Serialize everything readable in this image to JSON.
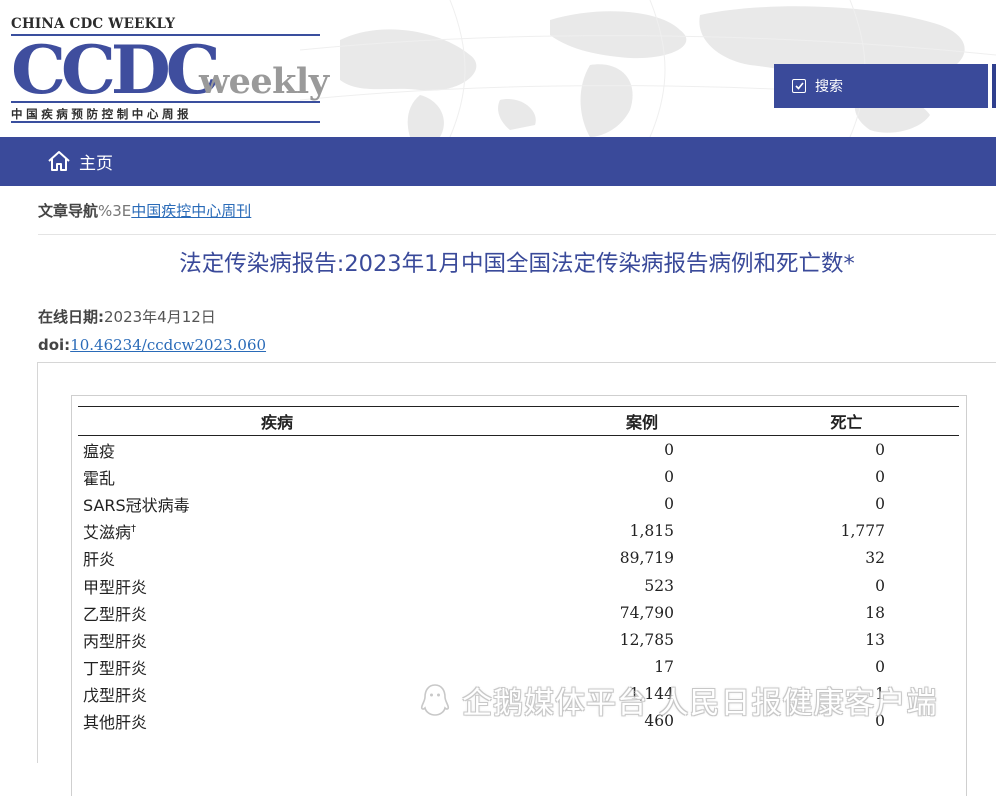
{
  "header": {
    "brand_top": "CHINA CDC WEEKLY",
    "logo_main": "CCDC",
    "logo_suffix": "weekly",
    "brand_subtitle": "中国疾病预防控制中心周报",
    "search_label": "搜索"
  },
  "nav": {
    "home_label": "主页"
  },
  "breadcrumb": {
    "label": "文章导航",
    "separator": "%3E",
    "link": "中国疾控中心周刊"
  },
  "article": {
    "title": "法定传染病报告:2023年1月中国全国法定传染病报告病例和死亡数*",
    "date_label": "在线日期:",
    "date_value": "2023年4月12日",
    "doi_label": "doi:",
    "doi_value": "10.46234/ccdcw2023.060"
  },
  "table": {
    "headers": {
      "disease": "疾病",
      "cases": "案例",
      "deaths": "死亡"
    },
    "rows": [
      {
        "disease": "瘟疫",
        "cases": "0",
        "deaths": "0"
      },
      {
        "disease": "霍乱",
        "cases": "0",
        "deaths": "0"
      },
      {
        "disease": "SARS冠状病毒",
        "cases": "0",
        "deaths": "0"
      },
      {
        "disease": "艾滋病",
        "sup": "†",
        "cases": "1,815",
        "deaths": "1,777"
      },
      {
        "disease": "肝炎",
        "cases": "89,719",
        "deaths": "32"
      },
      {
        "disease": "甲型肝炎",
        "cases": "523",
        "deaths": "0"
      },
      {
        "disease": "乙型肝炎",
        "cases": "74,790",
        "deaths": "18"
      },
      {
        "disease": "丙型肝炎",
        "cases": "12,785",
        "deaths": "13"
      },
      {
        "disease": "丁型肝炎",
        "cases": "17",
        "deaths": "0"
      },
      {
        "disease": "戊型肝炎",
        "cases": "1,144",
        "deaths": "1"
      },
      {
        "disease": "其他肝炎",
        "cases": "460",
        "deaths": "0"
      }
    ]
  },
  "watermark": {
    "text": "企鹅媒体平台 人民日报健康客户端"
  },
  "colors": {
    "brand_blue": "#3a4a9a",
    "link_blue": "#2a6bb8"
  },
  "icons": {
    "search_checkbox": "checkbox-checked-icon",
    "home": "home-icon",
    "watermark": "penguin-logo-icon"
  }
}
